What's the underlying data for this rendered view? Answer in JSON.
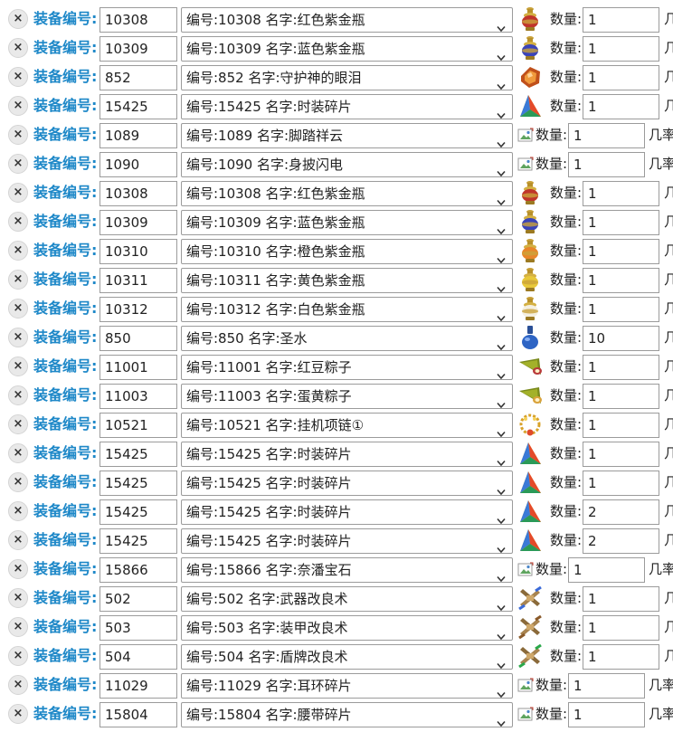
{
  "form": {
    "delete_label": "×",
    "equip_label": "装备编号:",
    "qty_label": "数量:",
    "suffix_text": "几率"
  },
  "rows": [
    {
      "id": "10308",
      "option": "编号:10308 名字:红色紫金瓶",
      "icon": "red-vase-icon",
      "qty": "1",
      "broken": false
    },
    {
      "id": "10309",
      "option": "编号:10309 名字:蓝色紫金瓶",
      "icon": "blue-vase-icon",
      "qty": "1",
      "broken": false
    },
    {
      "id": "852",
      "option": "编号:852 名字:守护神的眼泪",
      "icon": "amber-gem-icon",
      "qty": "1",
      "broken": false
    },
    {
      "id": "15425",
      "option": "编号:15425 名字:时装碎片",
      "icon": "fashion-shard-icon",
      "qty": "1",
      "broken": false
    },
    {
      "id": "1089",
      "option": "编号:1089 名字:脚踏祥云",
      "icon": "broken-image-icon",
      "qty": "1",
      "broken": true
    },
    {
      "id": "1090",
      "option": "编号:1090 名字:身披闪电",
      "icon": "broken-image-icon",
      "qty": "1",
      "broken": true
    },
    {
      "id": "10308",
      "option": "编号:10308 名字:红色紫金瓶",
      "icon": "red-vase-icon",
      "qty": "1",
      "broken": false
    },
    {
      "id": "10309",
      "option": "编号:10309 名字:蓝色紫金瓶",
      "icon": "blue-vase-icon",
      "qty": "1",
      "broken": false
    },
    {
      "id": "10310",
      "option": "编号:10310 名字:橙色紫金瓶",
      "icon": "orange-vase-icon",
      "qty": "1",
      "broken": false
    },
    {
      "id": "10311",
      "option": "编号:10311 名字:黄色紫金瓶",
      "icon": "yellow-vase-icon",
      "qty": "1",
      "broken": false
    },
    {
      "id": "10312",
      "option": "编号:10312 名字:白色紫金瓶",
      "icon": "white-vase-icon",
      "qty": "1",
      "broken": false
    },
    {
      "id": "850",
      "option": "编号:850 名字:圣水",
      "icon": "holy-water-flask-icon",
      "qty": "10",
      "broken": false
    },
    {
      "id": "11001",
      "option": "编号:11001 名字:红豆粽子",
      "icon": "red-bean-zongzi-icon",
      "qty": "1",
      "broken": false
    },
    {
      "id": "11003",
      "option": "编号:11003 名字:蛋黄粽子",
      "icon": "yolk-zongzi-icon",
      "qty": "1",
      "broken": false
    },
    {
      "id": "10521",
      "option": "编号:10521 名字:挂机项链①",
      "icon": "gold-necklace-icon",
      "qty": "1",
      "broken": false
    },
    {
      "id": "15425",
      "option": "编号:15425 名字:时装碎片",
      "icon": "fashion-shard-icon",
      "qty": "1",
      "broken": false
    },
    {
      "id": "15425",
      "option": "编号:15425 名字:时装碎片",
      "icon": "fashion-shard-icon",
      "qty": "1",
      "broken": false
    },
    {
      "id": "15425",
      "option": "编号:15425 名字:时装碎片",
      "icon": "fashion-shard-icon",
      "qty": "2",
      "broken": false
    },
    {
      "id": "15425",
      "option": "编号:15425 名字:时装碎片",
      "icon": "fashion-shard-icon",
      "qty": "2",
      "broken": false
    },
    {
      "id": "15866",
      "option": "编号:15866 名字:奈潘宝石",
      "icon": "broken-image-icon",
      "qty": "1",
      "broken": true
    },
    {
      "id": "502",
      "option": "编号:502 名字:武器改良术",
      "icon": "weapon-scroll-icon",
      "qty": "1",
      "broken": false
    },
    {
      "id": "503",
      "option": "编号:503 名字:装甲改良术",
      "icon": "armor-scroll-icon",
      "qty": "1",
      "broken": false
    },
    {
      "id": "504",
      "option": "编号:504 名字:盾牌改良术",
      "icon": "shield-scroll-icon",
      "qty": "1",
      "broken": false
    },
    {
      "id": "11029",
      "option": "编号:11029 名字:耳环碎片",
      "icon": "broken-image-icon",
      "qty": "1",
      "broken": true
    },
    {
      "id": "15804",
      "option": "编号:15804 名字:腰带碎片",
      "icon": "broken-image-icon",
      "qty": "1",
      "broken": true
    }
  ]
}
